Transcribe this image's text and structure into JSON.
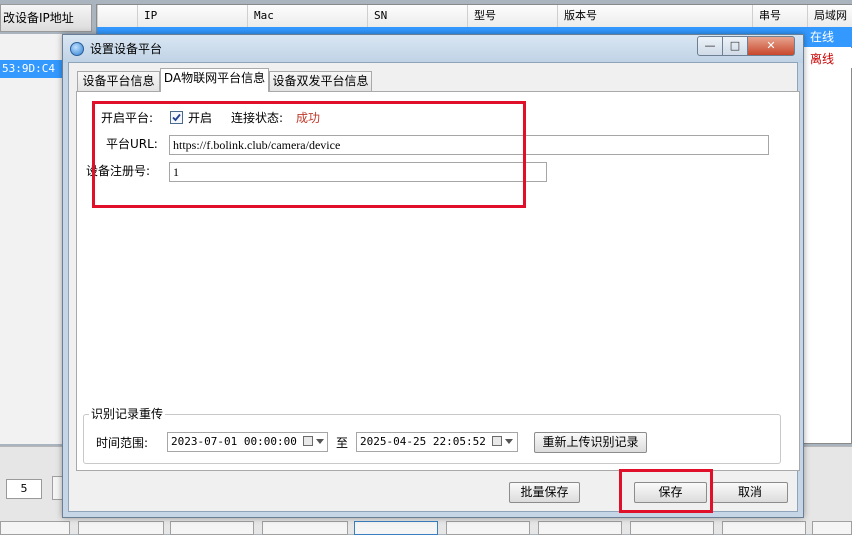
{
  "background": {
    "left_button_label": "改设备IP地址",
    "left_selected_row_text": "53:9D:C4",
    "grid_headers": [
      "IP",
      "Mac",
      "SN",
      "型号",
      "版本号",
      "串号",
      "局域网"
    ],
    "status_online": "在线",
    "status_offline": "离线",
    "page_size_value": "5"
  },
  "dialog": {
    "title": "设置设备平台",
    "window_buttons": {
      "minimize": "—",
      "maximize": "□",
      "close": "✕"
    },
    "tabs": [
      {
        "label": "设备平台信息",
        "active": false
      },
      {
        "label": "DA物联网平台信息",
        "active": true
      },
      {
        "label": "设备双发平台信息",
        "active": false
      }
    ],
    "platform": {
      "enable_label": "开启平台:",
      "enable_checked": true,
      "enable_value_label": "开启",
      "status_label": "连接状态:",
      "status_value": "成功",
      "status_color": "#c0392b",
      "url_label": "平台URL:",
      "url_value": "https://f.bolink.club/camera/device",
      "reg_label": "设备注册号:",
      "reg_value": "1"
    },
    "reupload": {
      "group_title": "识别记录重传",
      "range_label": "时间范围:",
      "start_time": "2023-07-01 00:00:00",
      "to_label": "至",
      "end_time": "2025-04-25 22:05:52",
      "button_label": "重新上传识别记录"
    },
    "footer": {
      "batch_save_label": "批量保存",
      "save_label": "保存",
      "cancel_label": "取消"
    },
    "highlight_color": "#e0102a"
  }
}
